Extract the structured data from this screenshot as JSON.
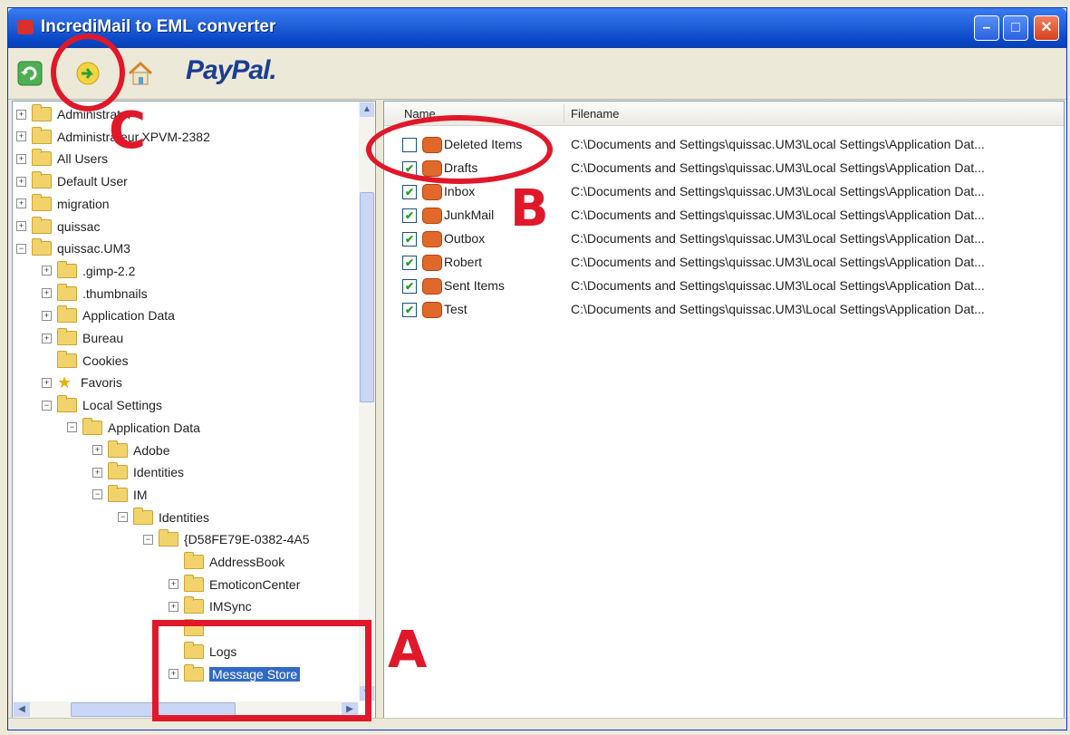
{
  "window": {
    "title": "IncrediMail to EML converter",
    "accent_color": "#0a48c8",
    "controls": [
      "minimize-icon",
      "maximize-icon",
      "close-icon"
    ]
  },
  "toolbar": {
    "buttons": [
      {
        "icon": "refresh-icon"
      },
      {
        "icon": "convert-icon"
      },
      {
        "icon": "home-icon"
      }
    ],
    "paypal_label": "PayPal",
    "paypal_dot": "."
  },
  "tree": {
    "nodes": [
      {
        "label": "Administrator",
        "expander": "+",
        "icon": "folder-icon"
      },
      {
        "label": "Administrateur.XPVM-2382",
        "expander": "+",
        "icon": "folder-icon"
      },
      {
        "label": "All Users",
        "expander": "+",
        "icon": "folder-icon"
      },
      {
        "label": "Default User",
        "expander": "+",
        "icon": "folder-icon"
      },
      {
        "label": "migration",
        "expander": "+",
        "icon": "folder-icon"
      },
      {
        "label": "quissac",
        "expander": "+",
        "icon": "folder-icon"
      },
      {
        "label": "quissac.UM3",
        "expander": "-",
        "icon": "folder-icon"
      },
      {
        "label": ".gimp-2.2",
        "expander": "+",
        "icon": "folder-icon"
      },
      {
        "label": ".thumbnails",
        "expander": "+",
        "icon": "folder-icon"
      },
      {
        "label": "Application Data",
        "expander": "+",
        "icon": "folder-icon"
      },
      {
        "label": "Bureau",
        "expander": "+",
        "icon": "folder-icon"
      },
      {
        "label": "Cookies",
        "expander": "",
        "icon": "folder-icon"
      },
      {
        "label": "Favoris",
        "expander": "+",
        "icon": "star-icon"
      },
      {
        "label": "Local Settings",
        "expander": "-",
        "icon": "folder-icon"
      },
      {
        "label": "Application Data",
        "expander": "-",
        "icon": "folder-icon"
      },
      {
        "label": "Adobe",
        "expander": "+",
        "icon": "folder-icon"
      },
      {
        "label": "Identities",
        "expander": "+",
        "icon": "folder-icon"
      },
      {
        "label": "IM",
        "expander": "-",
        "icon": "folder-icon"
      },
      {
        "label": "Identities",
        "expander": "-",
        "icon": "folder-icon"
      },
      {
        "label": "{D58FE79E-0382-4A5",
        "expander": "-",
        "icon": "folder-icon"
      },
      {
        "label": "AddressBook",
        "expander": "",
        "icon": "folder-icon"
      },
      {
        "label": "EmoticonCenter",
        "expander": "+",
        "icon": "folder-icon"
      },
      {
        "label": "IMSync",
        "expander": "+",
        "icon": "folder-icon"
      },
      {
        "label": "",
        "expander": "",
        "icon": "folder-icon"
      },
      {
        "label": "Logs",
        "expander": "",
        "icon": "folder-icon"
      },
      {
        "label": "Message Store",
        "expander": "+",
        "icon": "folder-icon",
        "selected": true
      }
    ]
  },
  "list": {
    "columns": {
      "name": "Name",
      "filename": "Filename"
    },
    "rows": [
      {
        "name": "Deleted Items",
        "checked": false,
        "filename": "C:\\Documents and Settings\\quissac.UM3\\Local Settings\\Application Dat..."
      },
      {
        "name": "Drafts",
        "checked": true,
        "filename": "C:\\Documents and Settings\\quissac.UM3\\Local Settings\\Application Dat..."
      },
      {
        "name": "Inbox",
        "checked": true,
        "filename": "C:\\Documents and Settings\\quissac.UM3\\Local Settings\\Application Dat..."
      },
      {
        "name": "JunkMail",
        "checked": true,
        "filename": "C:\\Documents and Settings\\quissac.UM3\\Local Settings\\Application Dat..."
      },
      {
        "name": "Outbox",
        "checked": true,
        "filename": "C:\\Documents and Settings\\quissac.UM3\\Local Settings\\Application Dat..."
      },
      {
        "name": "Robert",
        "checked": true,
        "filename": "C:\\Documents and Settings\\quissac.UM3\\Local Settings\\Application Dat..."
      },
      {
        "name": "Sent Items",
        "checked": true,
        "filename": "C:\\Documents and Settings\\quissac.UM3\\Local Settings\\Application Dat..."
      },
      {
        "name": "Test",
        "checked": true,
        "filename": "C:\\Documents and Settings\\quissac.UM3\\Local Settings\\Application Dat..."
      }
    ]
  },
  "annotations": {
    "color": "#e0182a",
    "labels": {
      "a": "A",
      "b": "B",
      "c": "C"
    }
  }
}
